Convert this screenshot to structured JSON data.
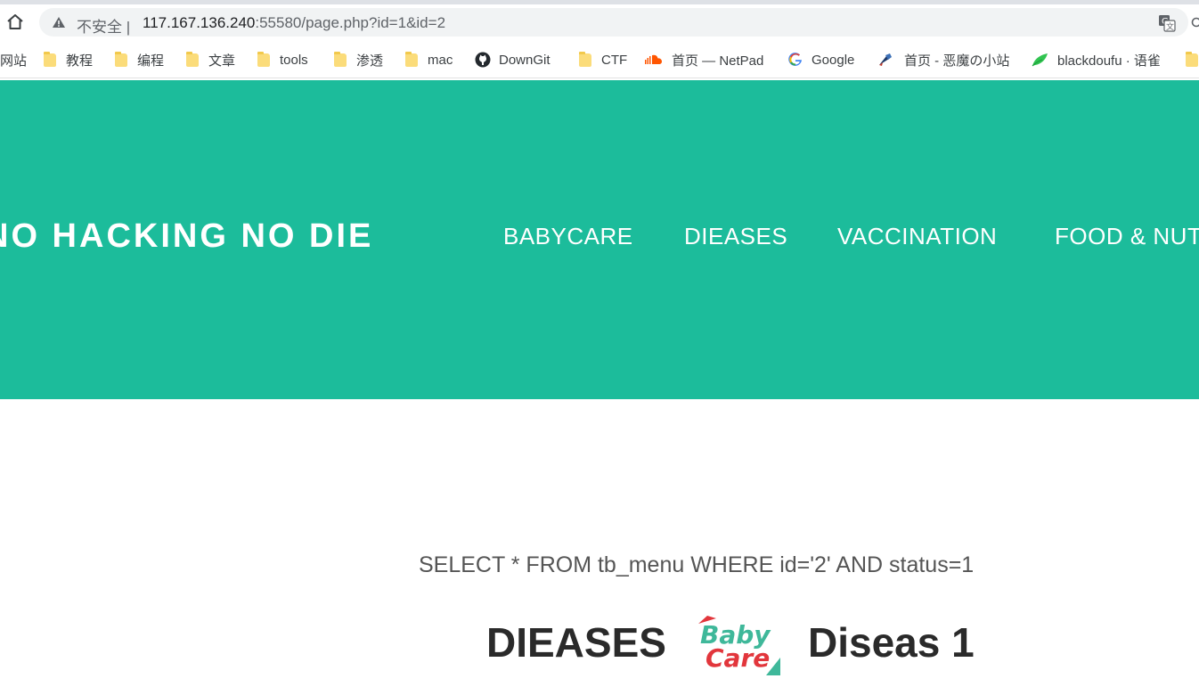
{
  "browser": {
    "security_label": "不安全",
    "separator": "|",
    "url_host": "117.167.136.240",
    "url_rest": ":55580/page.php?id=1&id=2"
  },
  "bookmarks": [
    {
      "label": "网站",
      "icon": "folder-icon"
    },
    {
      "label": "教程",
      "icon": "folder-icon"
    },
    {
      "label": "编程",
      "icon": "folder-icon"
    },
    {
      "label": "文章",
      "icon": "folder-icon"
    },
    {
      "label": "tools",
      "icon": "folder-icon"
    },
    {
      "label": "渗透",
      "icon": "folder-icon"
    },
    {
      "label": "mac",
      "icon": "folder-icon"
    },
    {
      "label": "DownGit",
      "icon": "github-icon"
    },
    {
      "label": "CTF",
      "icon": "folder-icon"
    },
    {
      "label": "首页 — NetPad",
      "icon": "soundcloud-icon"
    },
    {
      "label": "Google",
      "icon": "google-icon"
    },
    {
      "label": "首页 - 恶魔の小站",
      "icon": "devil-site-icon"
    },
    {
      "label": "blackdoufu · 语雀",
      "icon": "yuque-icon"
    }
  ],
  "site": {
    "brand": "NO HACKING NO DIE",
    "nav": [
      "BABYCARE",
      "DIEASES",
      "VACCINATION",
      "FOOD & NUTRITION"
    ]
  },
  "content": {
    "sql": "SELECT * FROM tb_menu WHERE id='2' AND status=1",
    "title_left": "DIEASES",
    "title_right": "Diseas 1",
    "logo_line1": "Baby",
    "logo_line2": "Care"
  },
  "colors": {
    "header_bg": "#1cbc9b",
    "folder": "#fbdc7a",
    "logo_green": "#3fb89a",
    "logo_red": "#e2363c"
  }
}
